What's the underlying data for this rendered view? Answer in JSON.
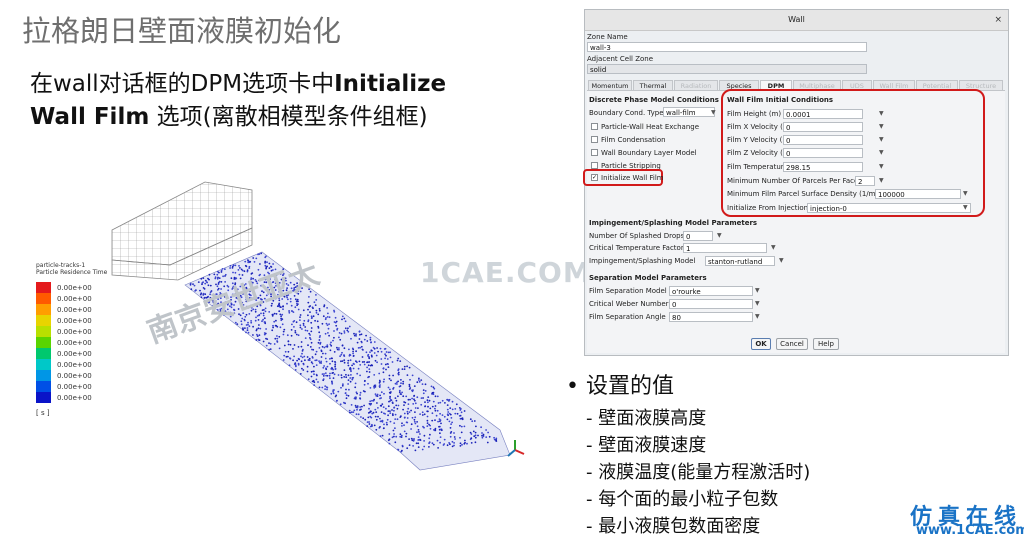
{
  "slide": {
    "title": "拉格朗日壁面液膜初始化",
    "subtitle_line1_prefix": "在wall对话框的DPM选项卡中",
    "subtitle_line1_bold": "Initialize",
    "subtitle_line2_bold": "Wall Film",
    "subtitle_line2_suffix": " 选项(离散相模型条件组框)"
  },
  "dialog": {
    "title": "Wall",
    "close_glyph": "×",
    "zone_name_label": "Zone Name",
    "zone_name_value": "wall-3",
    "adjacent_label": "Adjacent Cell Zone",
    "adjacent_value": "solid",
    "tabs": [
      "Momentum",
      "Thermal",
      "Radiation",
      "Species",
      "DPM",
      "Multiphase",
      "UDS",
      "Wall Film",
      "Potential",
      "Structure"
    ],
    "left": {
      "section_title": "Discrete Phase Model Conditions",
      "boundary_label": "Boundary Cond. Type",
      "boundary_value": "wall-film",
      "checkboxes": [
        "Particle-Wall Heat Exchange",
        "Film Condensation",
        "Wall Boundary Layer Model",
        "Particle Stripping",
        "Initialize Wall Film"
      ],
      "checked_mark": "✓"
    },
    "film": {
      "section_title": "Wall Film Initial Conditions",
      "rows": [
        {
          "label": "Film Height  (m)",
          "value": "0.0001"
        },
        {
          "label": "Film X Velocity  (m/s)",
          "value": "0"
        },
        {
          "label": "Film Y Velocity  (m/s)",
          "value": "0"
        },
        {
          "label": "Film Z Velocity  (m/s)",
          "value": "0"
        },
        {
          "label": "Film Temperature (k)",
          "value": "298.15"
        },
        {
          "label": "Minimum Number Of Parcels Per Face",
          "value": "2"
        },
        {
          "label": "Minimum Film Parcel Surface Density (1/m2)",
          "value": "100000"
        },
        {
          "label": "Initialize From Injection",
          "value": "injection-0"
        }
      ]
    },
    "impingement": {
      "section_title": "Impingement/Splashing Model Parameters",
      "rows": [
        {
          "label": "Number Of Splashed Drops",
          "value": "0"
        },
        {
          "label": "Critical Temperature Factor",
          "value": "1"
        },
        {
          "label": "Impingement/Splashing Model",
          "value": "stanton-rutland"
        }
      ]
    },
    "separation": {
      "section_title": "Separation Model Parameters",
      "rows": [
        {
          "label": "Film Separation Model",
          "value": "o'rourke"
        },
        {
          "label": "Critical Weber Number",
          "value": "0"
        },
        {
          "label": "Film Separation Angle",
          "value": "80"
        }
      ]
    },
    "buttons": {
      "ok": "OK",
      "cancel": "Cancel",
      "help": "Help"
    }
  },
  "legend": {
    "title1": "particle-tracks-1",
    "title2": "Particle Residence Time",
    "values": [
      "0.00e+00",
      "0.00e+00",
      "0.00e+00",
      "0.00e+00",
      "0.00e+00",
      "0.00e+00",
      "0.00e+00",
      "0.00e+00",
      "0.00e+00",
      "0.00e+00",
      "0.00e+00"
    ],
    "unit": "[ s ]",
    "colors": [
      "#e41a1c",
      "#ff5a00",
      "#ff9e00",
      "#e8d400",
      "#b8e000",
      "#5ad400",
      "#00c86e",
      "#00c8c8",
      "#0096e6",
      "#0050e6",
      "#0a14c8"
    ]
  },
  "bullets": {
    "title": "设置的值",
    "items": [
      "壁面液膜高度",
      "壁面液膜速度",
      "液膜温度(能量方程激活时)",
      "每个面的最小粒子包数",
      "最小液膜包数面密度"
    ]
  },
  "watermarks": {
    "cae": "1CAE.COM",
    "chinese": "南京安世亚太",
    "brand_cn": "仿真在线",
    "brand_url": "www.1CAE.com"
  }
}
